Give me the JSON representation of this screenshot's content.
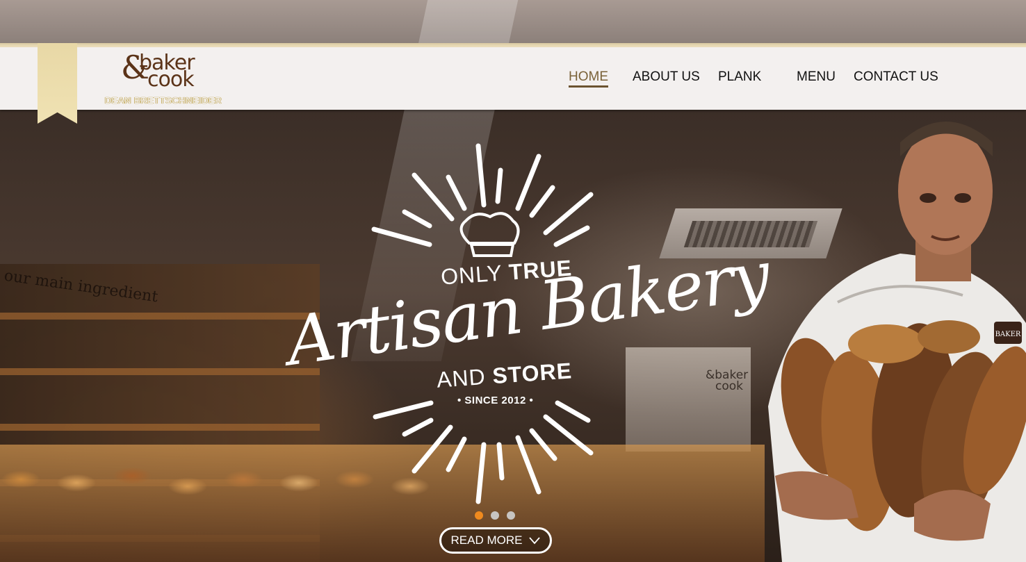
{
  "brand": {
    "logo_amp": "&",
    "logo_top": "baker",
    "logo_bottom": "cook",
    "subtitle": "DEAN BRETTSCHNEIDER"
  },
  "nav": {
    "items": [
      {
        "label": "HOME",
        "active": true
      },
      {
        "label": "ABOUT US",
        "active": false
      },
      {
        "label": "PLANK",
        "active": false
      },
      {
        "label": "MENU",
        "active": false
      },
      {
        "label": "CONTACT US",
        "active": false
      }
    ]
  },
  "hero": {
    "only": "ONLY",
    "true": "TRUE",
    "title": "Artisan Bakery",
    "and": "AND",
    "store": "STORE",
    "since": "• SINCE 2012 •",
    "wall_text": "our main ingredient",
    "wall_logo_top": "&baker",
    "wall_logo_bottom": "cook",
    "apron_badge": "BAKER",
    "read_more": "READ MORE",
    "read_more_icon": "chevron-down-icon"
  },
  "slider": {
    "count": 3,
    "active_index": 0
  },
  "colors": {
    "header_bg": "#f3f0ef",
    "ribbon": "#e8d8a6",
    "logo_brown": "#5b3318",
    "nav_active": "#7a6238",
    "dot_active": "#f08a1e",
    "dot_inactive": "#c7c4c1"
  }
}
